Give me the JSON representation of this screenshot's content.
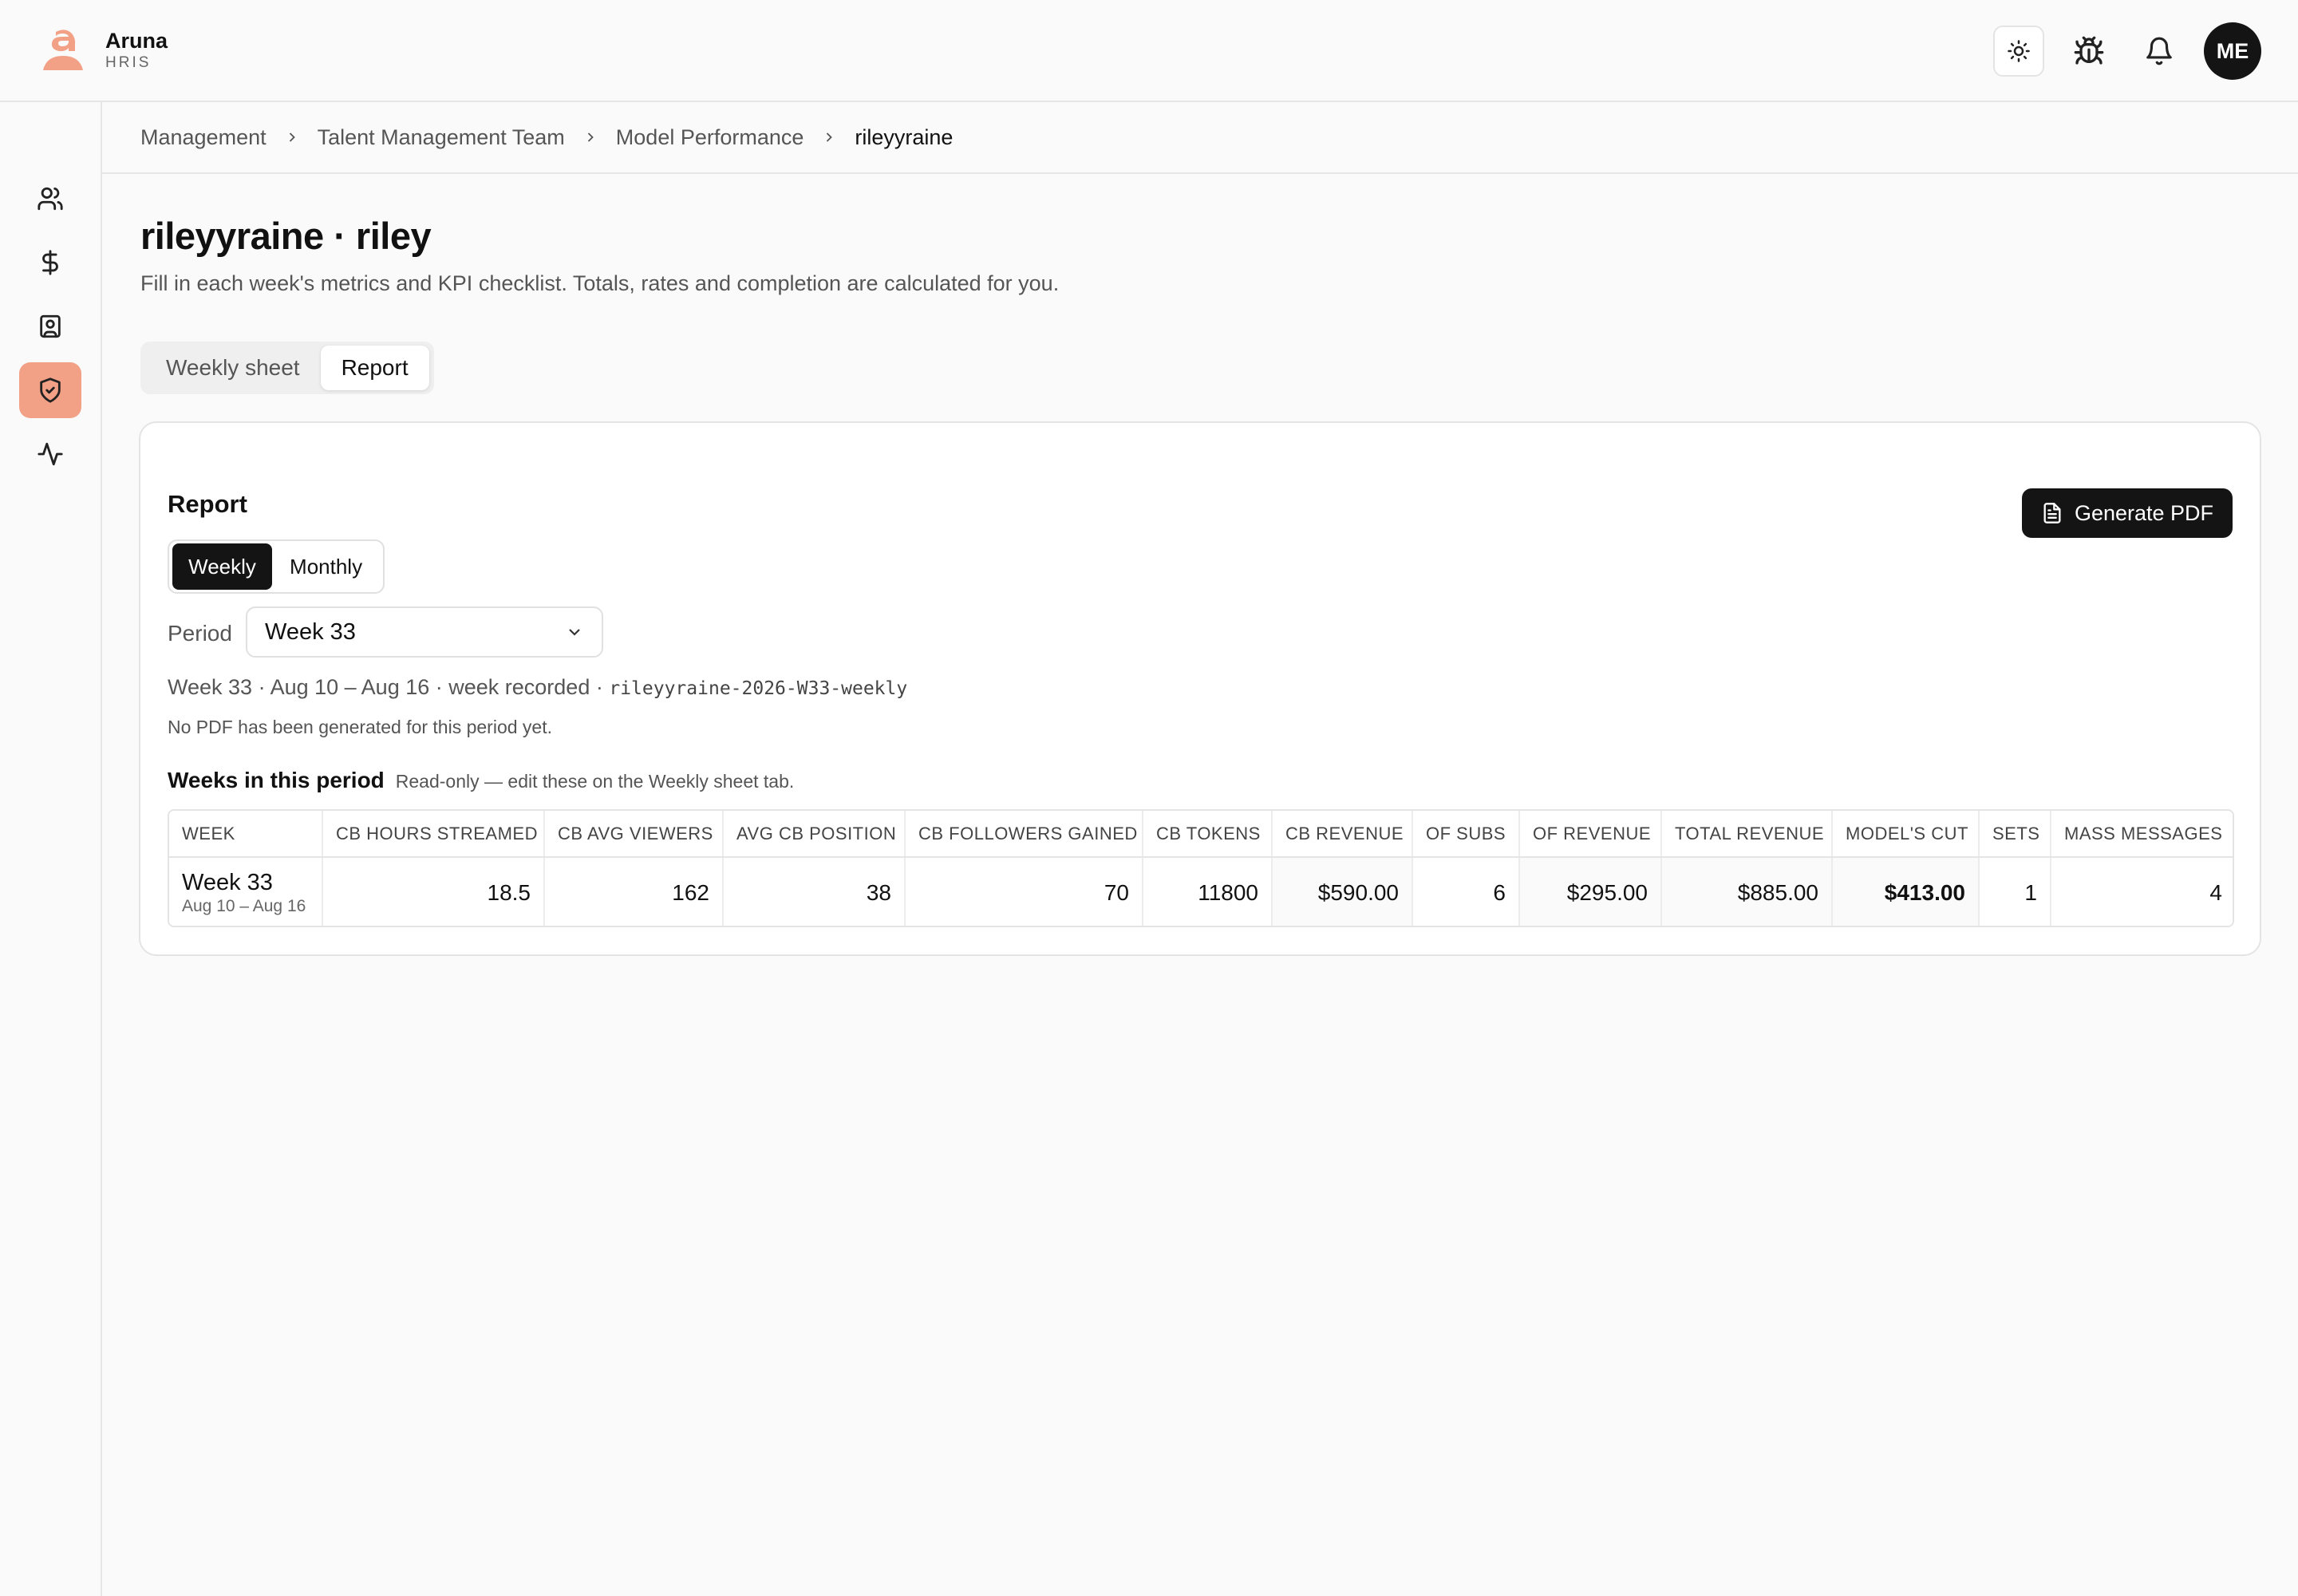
{
  "app": {
    "name": "Aruna",
    "subtitle": "HRIS",
    "avatar_initials": "ME",
    "accent": "#f2a186"
  },
  "breadcrumb": [
    "Management",
    "Talent Management Team",
    "Model Performance",
    "rileyyraine"
  ],
  "page": {
    "title": "rileyyraine · riley",
    "description": "Fill in each week's metrics and KPI checklist. Totals, rates and completion are calculated for you."
  },
  "tabs": [
    {
      "label": "Weekly sheet",
      "active": false
    },
    {
      "label": "Report",
      "active": true
    }
  ],
  "report": {
    "title": "Report",
    "generate_label": "Generate PDF",
    "modes": [
      {
        "label": "Weekly",
        "active": true
      },
      {
        "label": "Monthly",
        "active": false
      }
    ],
    "period_label": "Period",
    "period_value": "Week 33",
    "period_info": "Week 33 · Aug 10 – Aug 16 · week recorded · ",
    "period_code": "rileyyraine-2026-W33-weekly",
    "no_pdf": "No PDF has been generated for this period yet.",
    "weeks_title": "Weeks in this period",
    "weeks_note": "Read-only — edit these on the Weekly sheet tab."
  },
  "table": {
    "columns": [
      "Week",
      "CB Hours Streamed",
      "CB Avg Viewers",
      "Avg CB Position",
      "CB Followers Gained",
      "CB Tokens",
      "CB Revenue",
      "OF Subs",
      "OF Revenue",
      "Total Revenue",
      "Model's Cut",
      "Sets",
      "Mass Messages"
    ],
    "rows": [
      {
        "week": "Week 33",
        "range": "Aug 10 – Aug 16",
        "values": [
          "18.5",
          "162",
          "38",
          "70",
          "11800",
          "$590.00",
          "6",
          "$295.00",
          "$885.00",
          "$413.00",
          "1",
          "4"
        ]
      }
    ]
  }
}
